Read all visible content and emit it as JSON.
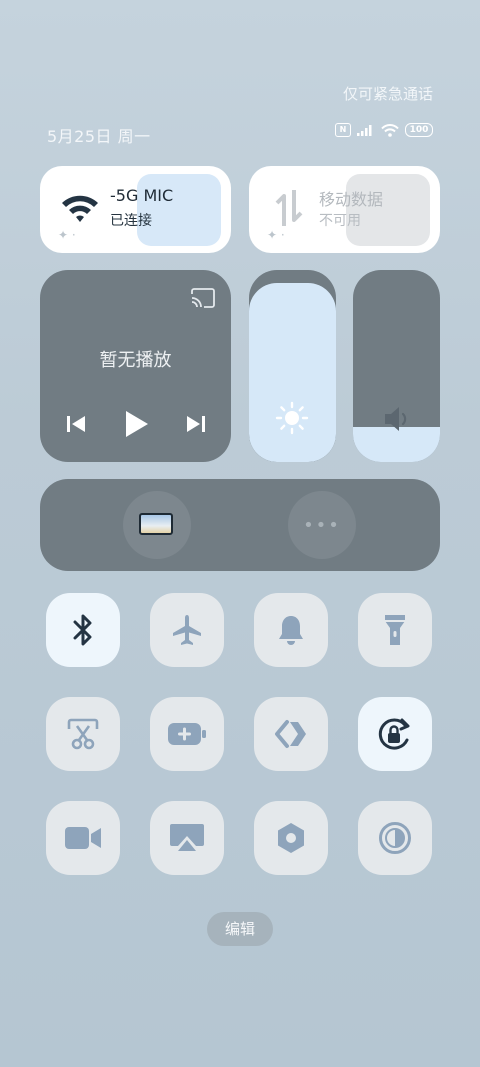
{
  "status_bar": {
    "emergency_text": "仅可紧急通话",
    "date_text": "5月25日 周一",
    "sim_label": "",
    "battery_text": "100"
  },
  "wifi_tile": {
    "name": "-5G  MIC",
    "status": "已连接"
  },
  "mobile_tile": {
    "name": "移动数据",
    "status": "不可用"
  },
  "media": {
    "title": "暂无播放"
  },
  "brightness": {
    "level": 0.93
  },
  "volume": {
    "level": 0.18
  },
  "toggles": [
    {
      "icon": "bluetooth-icon",
      "active": true
    },
    {
      "icon": "airplane-icon",
      "active": false
    },
    {
      "icon": "bell-icon",
      "active": false
    },
    {
      "icon": "flashlight-icon",
      "active": false
    },
    {
      "icon": "screenshot-icon",
      "active": false
    },
    {
      "icon": "battery-saver-icon",
      "active": false
    },
    {
      "icon": "link-share-icon",
      "active": false
    },
    {
      "icon": "rotation-lock-icon",
      "active": true
    },
    {
      "icon": "screen-record-icon",
      "active": false
    },
    {
      "icon": "screen-cast-icon",
      "active": false
    },
    {
      "icon": "settings-hex-icon",
      "active": false
    },
    {
      "icon": "dark-mode-icon",
      "active": false
    }
  ],
  "edit_button": {
    "label": "编辑"
  },
  "colors": {
    "tile_dark": "#717c83",
    "accent_light": "#d6e8f8",
    "icon": "#8ea4bb",
    "icon_dark": "#243443"
  }
}
